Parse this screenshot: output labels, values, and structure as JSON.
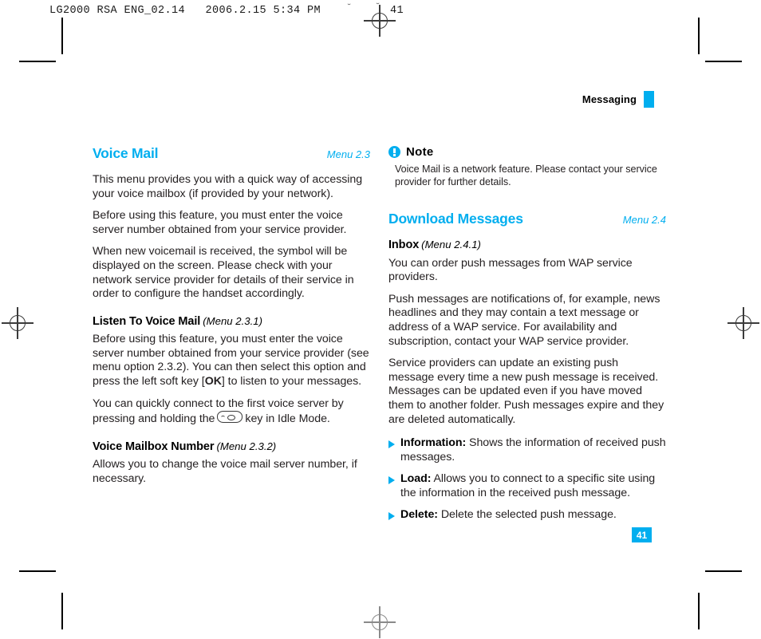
{
  "prepress": {
    "slug": "LG2000 RSA ENG_02.14   2006.2.15 5:34 PM",
    "slug_page": "41",
    "tilde_left": "˘",
    "tilde_right": "˘"
  },
  "running_head": {
    "label": "Messaging",
    "accent_color": "#00aeef"
  },
  "left_column": {
    "section": {
      "title": "Voice Mail",
      "menu_ref": "Menu 2.3"
    },
    "paragraphs": [
      "This menu provides you with a quick way of accessing your voice mailbox (if provided by your network).",
      "Before using this feature, you must enter the voice server number obtained from your service provider.",
      "When new voicemail is received, the symbol will be displayed on the screen. Please check with your network service provider for details of their service in order to configure the handset accordingly."
    ],
    "sub_sections": [
      {
        "title": "Listen To Voice Mail",
        "menu_ref": "(Menu 2.3.1)",
        "para_1_before_ok": "Before using this feature, you must enter the voice server number obtained from your service provider (see menu option 2.3.2). You can then select this option and press the left soft key [",
        "ok_label": "OK",
        "para_1_after_ok": "] to listen to your messages.",
        "para_2_before_key": "You can quickly connect to the first voice server by pressing and holding the",
        "key_icon": "voicemail-key-icon",
        "para_2_after_key": "key in Idle Mode."
      },
      {
        "title": "Voice Mailbox Number",
        "menu_ref": "(Menu 2.3.2)",
        "para": "Allows you to change the voice mail server number, if necessary."
      }
    ]
  },
  "right_column": {
    "note": {
      "icon": "info-exclamation-icon",
      "title": "Note",
      "body": "Voice Mail is a network feature. Please contact your service provider for further details."
    },
    "section": {
      "title": "Download Messages",
      "menu_ref": "Menu 2.4"
    },
    "sub_section": {
      "title": "Inbox",
      "menu_ref": "(Menu 2.4.1)"
    },
    "paragraphs": [
      "You can order push messages from WAP service providers.",
      "Push messages are notifications of, for example, news headlines and they may contain a text message or address of a WAP service. For availability and subscription, contact your WAP service provider.",
      "Service providers can update an existing push message every time a new push message is received. Messages can be updated even if you have moved them to another folder. Push messages expire and they are deleted automatically."
    ],
    "bullets": [
      {
        "label": "Information:",
        "text": " Shows the information of received push messages."
      },
      {
        "label": "Load:",
        "text": " Allows you to connect to a specific site using the information in the received push message."
      },
      {
        "label": "Delete:",
        "text": " Delete the selected push message."
      }
    ]
  },
  "folio": {
    "page_number": "41"
  }
}
